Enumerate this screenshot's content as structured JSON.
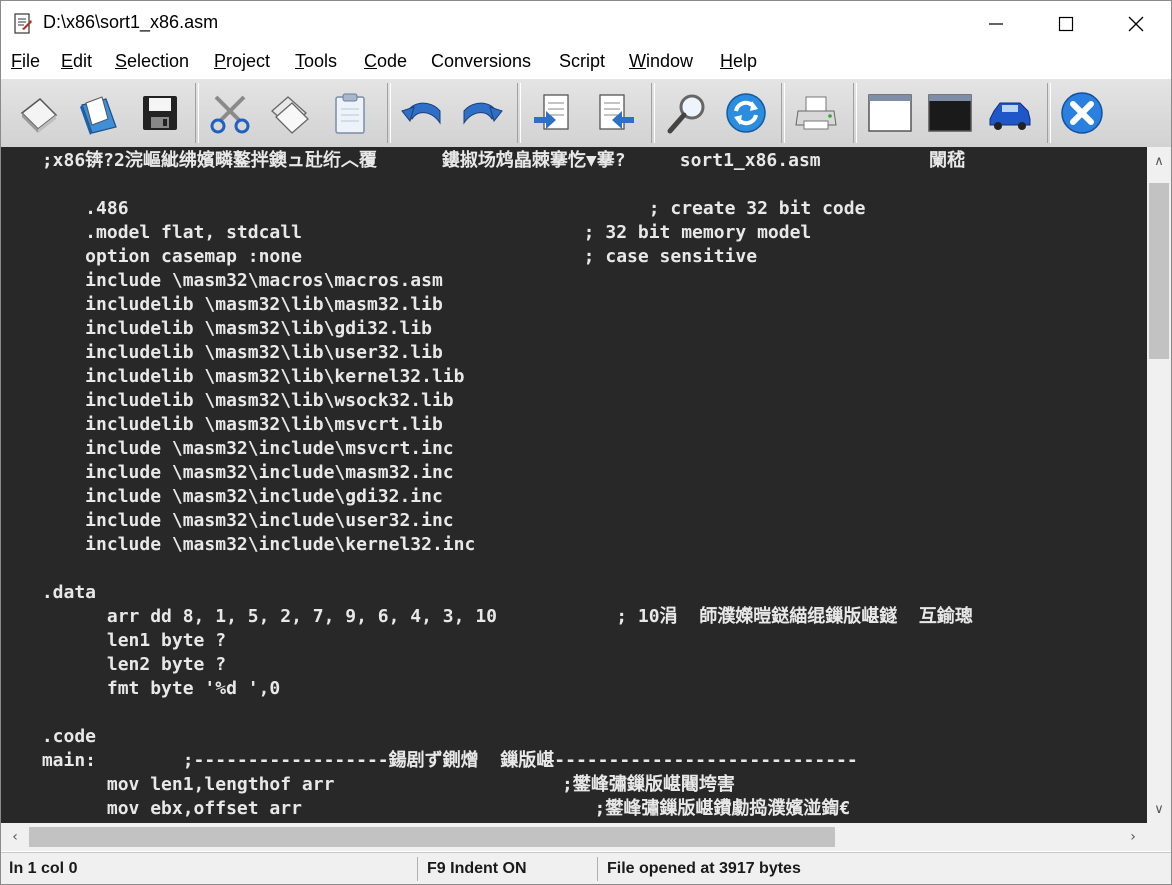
{
  "window": {
    "title": "D:\\x86\\sort1_x86.asm"
  },
  "menu": {
    "items": [
      {
        "label": "File",
        "accel": "F",
        "rest": "ile"
      },
      {
        "label": "Edit",
        "accel": "E",
        "rest": "dit"
      },
      {
        "label": "Selection",
        "accel": "S",
        "rest": "election"
      },
      {
        "label": "Project",
        "accel": "P",
        "rest": "roject"
      },
      {
        "label": "Tools",
        "accel": "T",
        "rest": "ools"
      },
      {
        "label": "Code",
        "accel": "C",
        "rest": "ode"
      },
      {
        "label": "Conversions",
        "accel": "",
        "rest": "Conversions"
      },
      {
        "label": "Script",
        "accel": "",
        "rest": "Script"
      },
      {
        "label": "Window",
        "accel": "W",
        "rest": "indow"
      },
      {
        "label": "Help",
        "accel": "H",
        "rest": "elp"
      }
    ]
  },
  "toolbar": {
    "icons": [
      "new-file-icon",
      "open-file-icon",
      "save-icon",
      "cut-icon",
      "copy-icon",
      "paste-icon",
      "undo-icon",
      "redo-icon",
      "import-icon",
      "export-icon",
      "find-icon",
      "refresh-icon",
      "print-icon",
      "window-icon",
      "console-icon",
      "run-icon",
      "exit-icon"
    ]
  },
  "editor": {
    "lines": [
      " ;x86锛?2浣嶇紪绋嬪疄鐜拌鐭ュ瓧绗︿覆      鏤掓场鸩皛棘搴忔▼搴?     sort1_x86.asm          闌嵇",
      "",
      "     .486                                                ; create 32 bit code",
      "     .model flat, stdcall                          ; 32 bit memory model",
      "     option casemap :none                          ; case sensitive",
      "     include \\masm32\\macros\\macros.asm",
      "     includelib \\masm32\\lib\\masm32.lib",
      "     includelib \\masm32\\lib\\gdi32.lib",
      "     includelib \\masm32\\lib\\user32.lib",
      "     includelib \\masm32\\lib\\kernel32.lib",
      "     includelib \\masm32\\lib\\wsock32.lib",
      "     includelib \\masm32\\lib\\msvcrt.lib",
      "     include \\masm32\\include\\msvcrt.inc",
      "     include \\masm32\\include\\masm32.inc",
      "     include \\masm32\\include\\gdi32.inc",
      "     include \\masm32\\include\\user32.inc",
      "     include \\masm32\\include\\kernel32.inc",
      "",
      " .data",
      "       arr dd 8, 1, 5, 2, 7, 9, 6, 4, 3, 10           ; 10涓  師濮嬫暟鎹緢绲鏁版嵁鐩  互鍮璁",
      "       len1 byte ?",
      "       len2 byte ?",
      "       fmt byte '%d ',0",
      "",
      " .code",
      " main:        ;------------------鍚剧ず鍘熷  鏁版嵁----------------------------",
      "       mov len1,lengthof arr                     ;鐢峰彇鏁版嵁闀垮害",
      "       mov ebx,offset arr                           ;鐢峰彇鏁版嵁鐨勮捣濮嬪湴鍧€"
    ]
  },
  "status": {
    "position": "ln 1 col 0",
    "indent": "F9 Indent ON",
    "message": "File opened at 3917 bytes"
  }
}
